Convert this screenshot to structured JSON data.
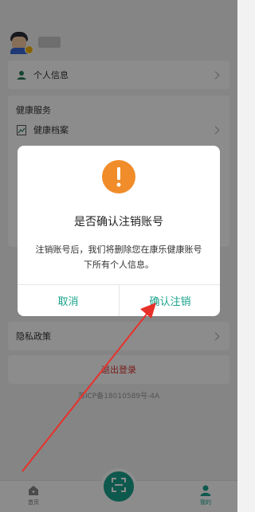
{
  "profile": {
    "avatar_icon": "user-avatar-icon"
  },
  "personal_info": {
    "label": "个人信息"
  },
  "health_services": {
    "title": "健康服务",
    "items": [
      {
        "label": "健康档案"
      }
    ]
  },
  "privacy": {
    "label": "隐私政策"
  },
  "logout": {
    "label": "退出登录"
  },
  "icp": {
    "text": "苏ICP备18010589号-4A"
  },
  "tabbar": {
    "home_label": "首页",
    "mine_label": "我的"
  },
  "dialog": {
    "title": "是否确认注销账号",
    "message": "注销账号后，我们将删除您在康乐健康账号下所有个人信息。",
    "cancel_label": "取消",
    "confirm_label": "确认注销"
  },
  "colors": {
    "accent": "#1aa38c",
    "warning": "#f08c2a",
    "logout": "#d33333",
    "annotation_arrow": "#e8302a"
  }
}
